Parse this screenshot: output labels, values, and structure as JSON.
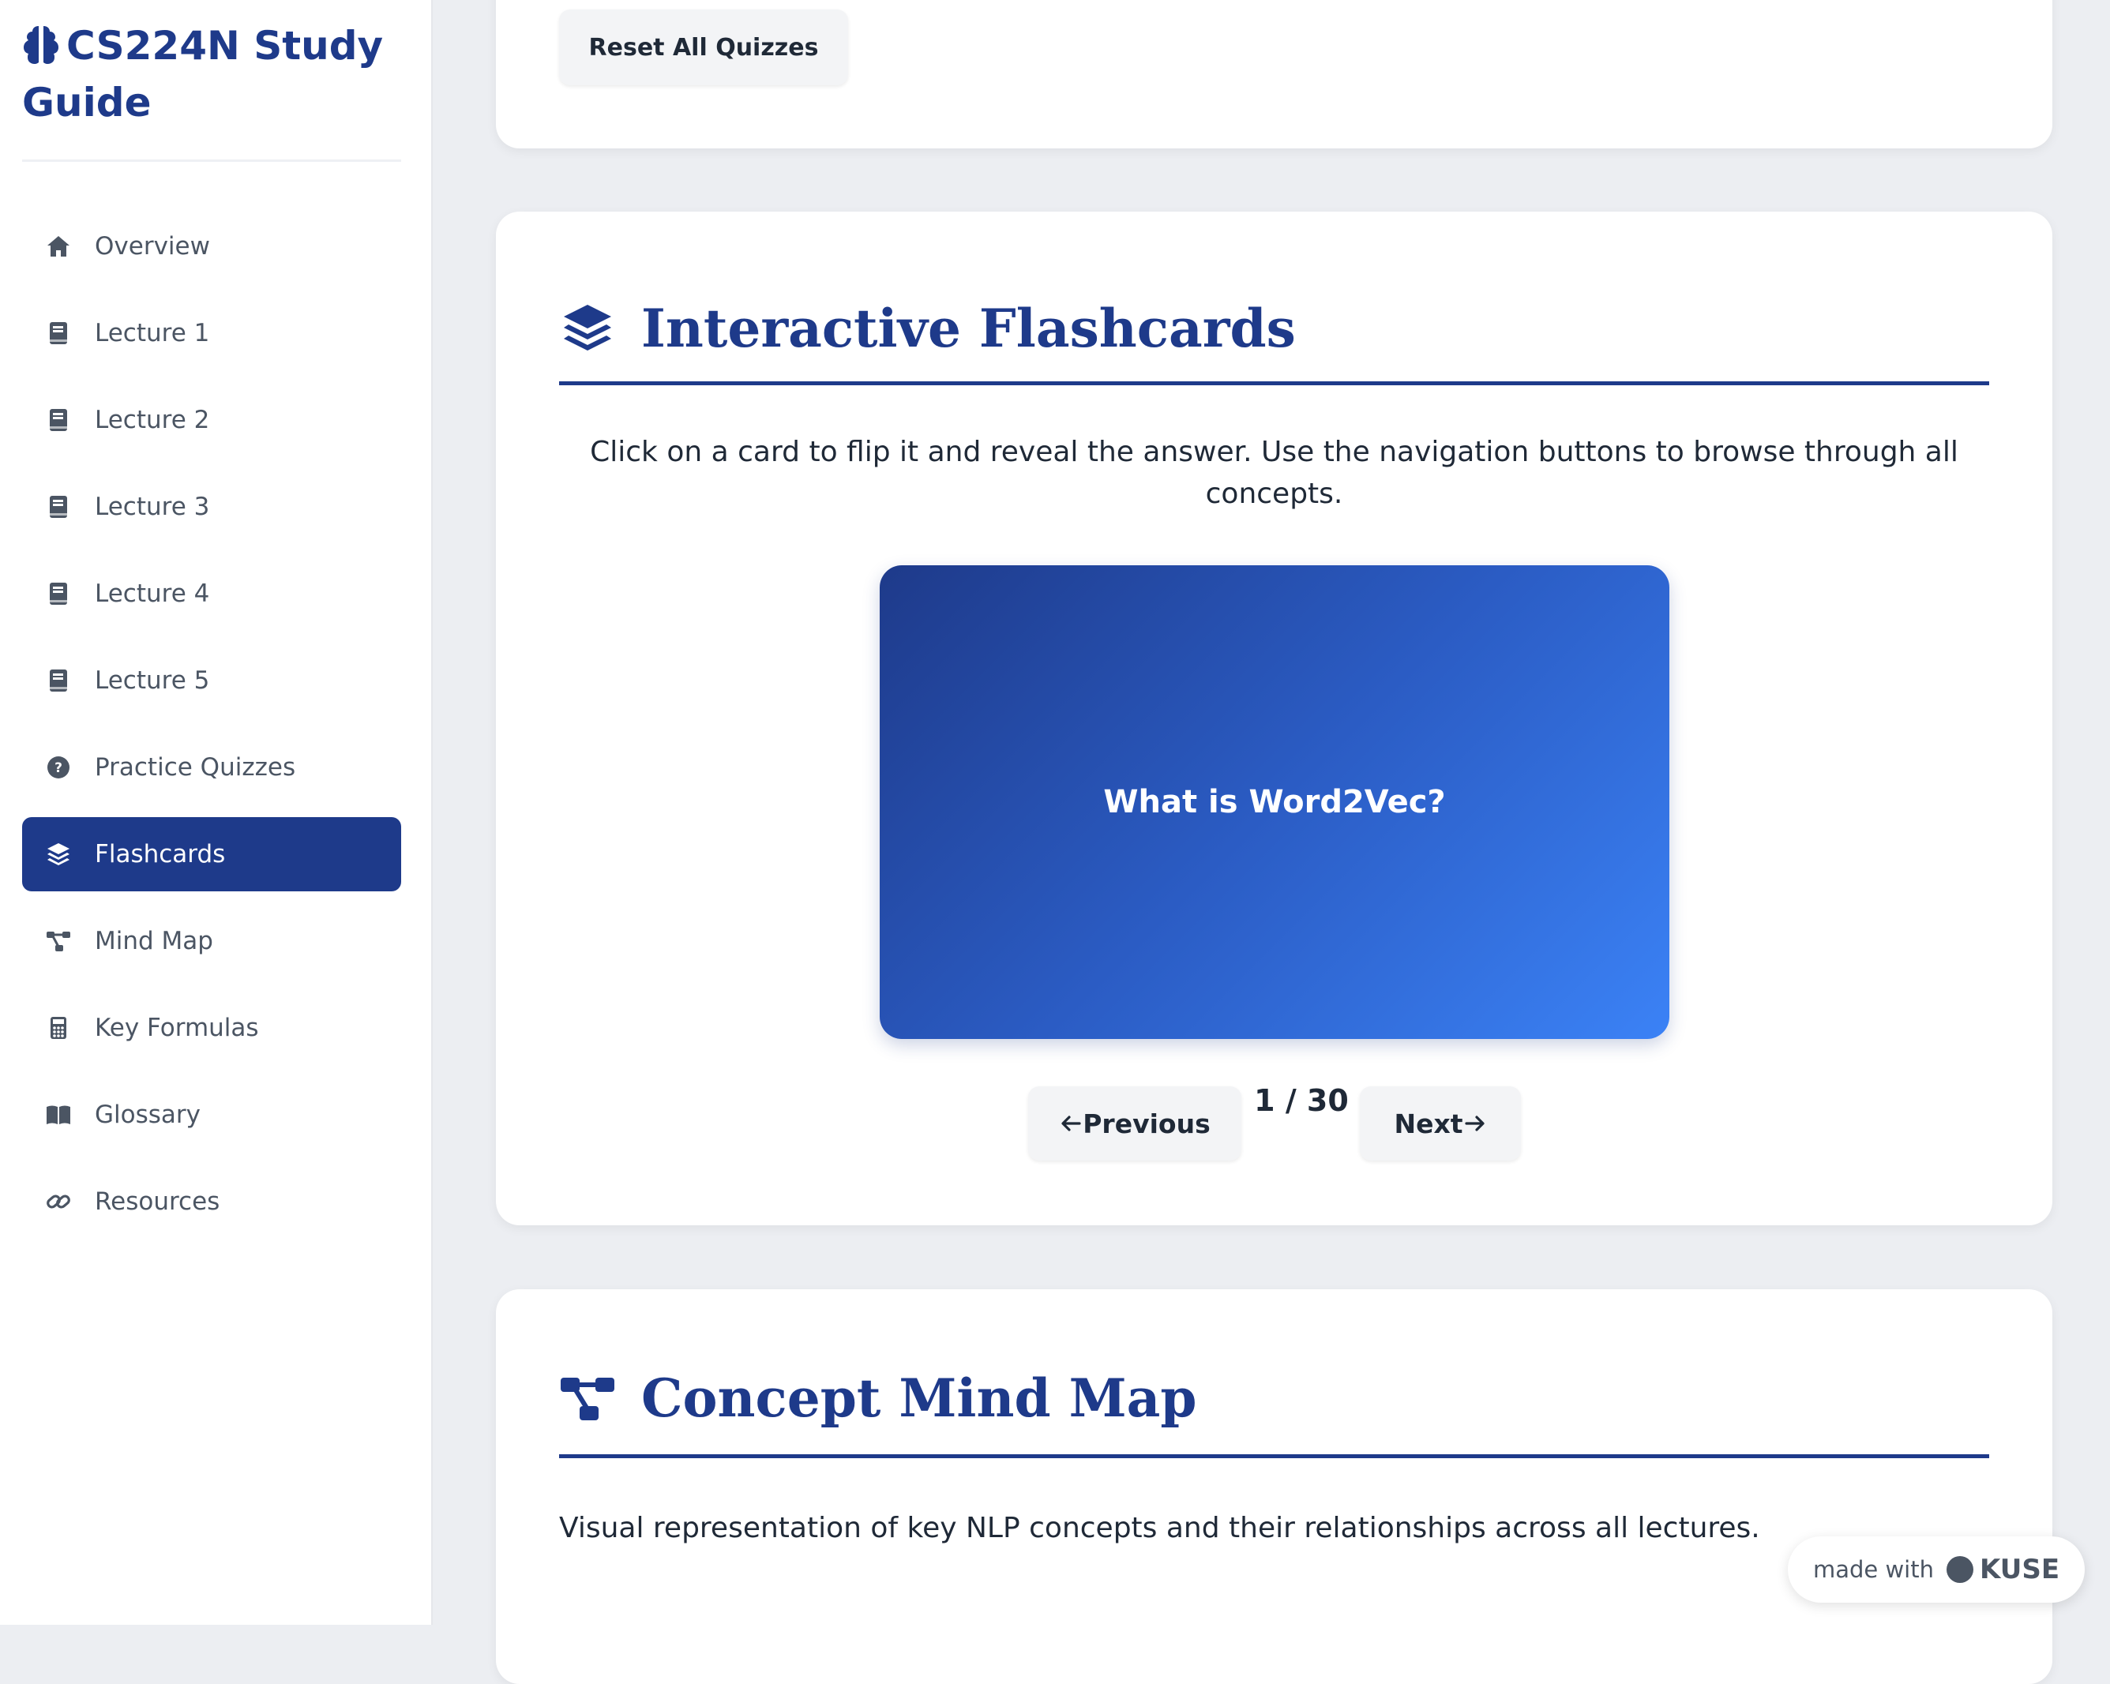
{
  "sidebar": {
    "brand": "CS224N Study Guide",
    "items": [
      {
        "label": "Overview",
        "icon": "home-icon",
        "active": false
      },
      {
        "label": "Lecture 1",
        "icon": "book-icon",
        "active": false
      },
      {
        "label": "Lecture 2",
        "icon": "book-icon",
        "active": false
      },
      {
        "label": "Lecture 3",
        "icon": "book-icon",
        "active": false
      },
      {
        "label": "Lecture 4",
        "icon": "book-icon",
        "active": false
      },
      {
        "label": "Lecture 5",
        "icon": "book-icon",
        "active": false
      },
      {
        "label": "Practice Quizzes",
        "icon": "question-circle-icon",
        "active": false
      },
      {
        "label": "Flashcards",
        "icon": "layers-icon",
        "active": true
      },
      {
        "label": "Mind Map",
        "icon": "sitemap-icon",
        "active": false
      },
      {
        "label": "Key Formulas",
        "icon": "calculator-icon",
        "active": false
      },
      {
        "label": "Glossary",
        "icon": "open-book-icon",
        "active": false
      },
      {
        "label": "Resources",
        "icon": "link-icon",
        "active": false
      }
    ]
  },
  "quizzes": {
    "reset_label": "Reset All Quizzes"
  },
  "flashcards": {
    "title": "Interactive Flashcards",
    "intro": "Click on a card to flip it and reveal the answer. Use the navigation buttons to browse through all concepts.",
    "card_text": "What is Word2Vec?",
    "prev_label": "Previous",
    "next_label": "Next",
    "counter": "1 / 30"
  },
  "mindmap": {
    "title": "Concept Mind Map",
    "description": "Visual representation of key NLP concepts and their relationships across all lectures."
  },
  "badge": {
    "prefix": "made with",
    "brand": "KUSE"
  },
  "colors": {
    "primary": "#1e3a8a",
    "accent": "#3b82f6",
    "background": "#eceef2"
  }
}
